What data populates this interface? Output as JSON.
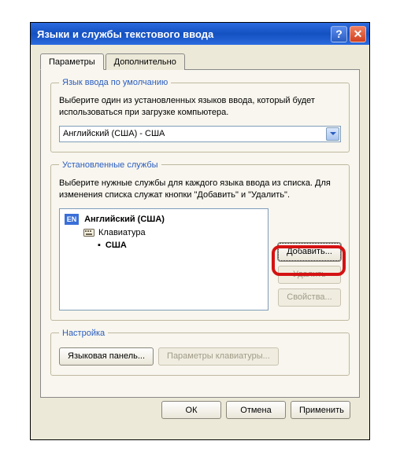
{
  "window": {
    "title": "Языки и службы текстового ввода",
    "help_label": "?",
    "close_label": "✕"
  },
  "tabs": {
    "parameters": "Параметры",
    "advanced": "Дополнительно"
  },
  "default_lang": {
    "legend": "Язык ввода по умолчанию",
    "desc": "Выберите один из установленных языков ввода, который будет использоваться при загрузке компьютера.",
    "value": "Английский (США) - США"
  },
  "installed": {
    "legend": "Установленные службы",
    "desc": "Выберите нужные службы для каждого языка ввода из списка. Для изменения списка служат кнопки \"Добавить\" и \"Удалить\".",
    "lang_badge": "EN",
    "lang_name": "Английский (США)",
    "keyboard_label": "Клавиатура",
    "layout": "США",
    "add": "Добавить...",
    "remove": "Удалить",
    "properties": "Свойства..."
  },
  "settings": {
    "legend": "Настройка",
    "lang_panel": "Языковая панель...",
    "kb_params": "Параметры клавиатуры..."
  },
  "buttons": {
    "ok": "ОК",
    "cancel": "Отмена",
    "apply": "Применить"
  }
}
